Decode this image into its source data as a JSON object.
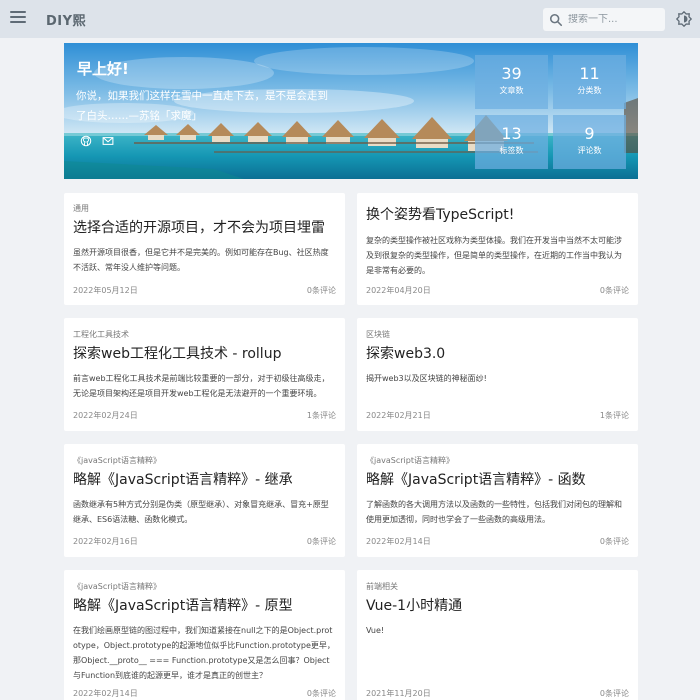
{
  "header": {
    "brand": "DIY熙",
    "search_placeholder": "搜索一下..."
  },
  "banner": {
    "greeting": "早上好!",
    "quote": "你说，如果我们这样在雪中一直走下去，是不是会走到了白头……—苏铭「求魔」",
    "stats": [
      {
        "value": "39",
        "label": "文章数"
      },
      {
        "value": "11",
        "label": "分类数"
      },
      {
        "value": "13",
        "label": "标签数"
      },
      {
        "value": "9",
        "label": "评论数"
      }
    ]
  },
  "posts": [
    {
      "category": "通用",
      "title": "选择合适的开源项目，才不会为项目埋雷",
      "desc": "虽然开源项目很香，但是它并不是完美的。例如可能存在Bug、社区热度不活跃、常年没人维护等问题。",
      "date": "2022年05月12日",
      "comments": "0条评论"
    },
    {
      "category": "",
      "title": "换个姿势看TypeScript!",
      "desc": "复杂的类型操作被社区戏称为类型体操。我们在开发当中当然不太可能涉及到很复杂的类型操作，但是简单的类型操作，在近期的工作当中我认为是非常有必要的。",
      "date": "2022年04月20日",
      "comments": "0条评论"
    },
    {
      "category": "工程化工具技术",
      "title": "探索web工程化工具技术 - rollup",
      "desc": "前言web工程化工具技术是前端比较重要的一部分，对于初级往高级走，无论是项目架构还是项目开发web工程化是无法避开的一个重要环境。",
      "date": "2022年02月24日",
      "comments": "1条评论"
    },
    {
      "category": "区块链",
      "title": "探索web3.0",
      "desc": "揭开web3以及区块链的神秘面纱!",
      "date": "2022年02月21日",
      "comments": "1条评论"
    },
    {
      "category": "《javaScript语言精粹》",
      "title": "略解《JavaScript语言精粹》- 继承",
      "desc": "函数继承有5种方式分别是伪类（原型继承）、对象冒充继承、冒充+原型继承、ES6语法糖、函数化模式。",
      "date": "2022年02月16日",
      "comments": "0条评论"
    },
    {
      "category": "《javaScript语言精粹》",
      "title": "略解《JavaScript语言精粹》- 函数",
      "desc": "了解函数的各大调用方法以及函数的一些特性，包括我们对闭包的理解和使用更加透彻，同时也学会了一些函数的高级用法。",
      "date": "2022年02月14日",
      "comments": "0条评论"
    },
    {
      "category": "《javaScript语言精粹》",
      "title": "略解《JavaScript语言精粹》- 原型",
      "desc": "在我们绘画原型链的图过程中，我们知道紧接在null之下的是Object.prototype，Object.prototype的起源地位似乎比Function.prototype更早，那Object.__proto__ === Function.prototype又是怎么回事？Object与Function到底谁的起源更早，谁才是真正的创世主？",
      "date": "2022年02月14日",
      "comments": "0条评论"
    },
    {
      "category": "前端相关",
      "title": "Vue-1小时精通",
      "desc": "Vue!",
      "date": "2021年11月20日",
      "comments": "0条评论"
    }
  ]
}
